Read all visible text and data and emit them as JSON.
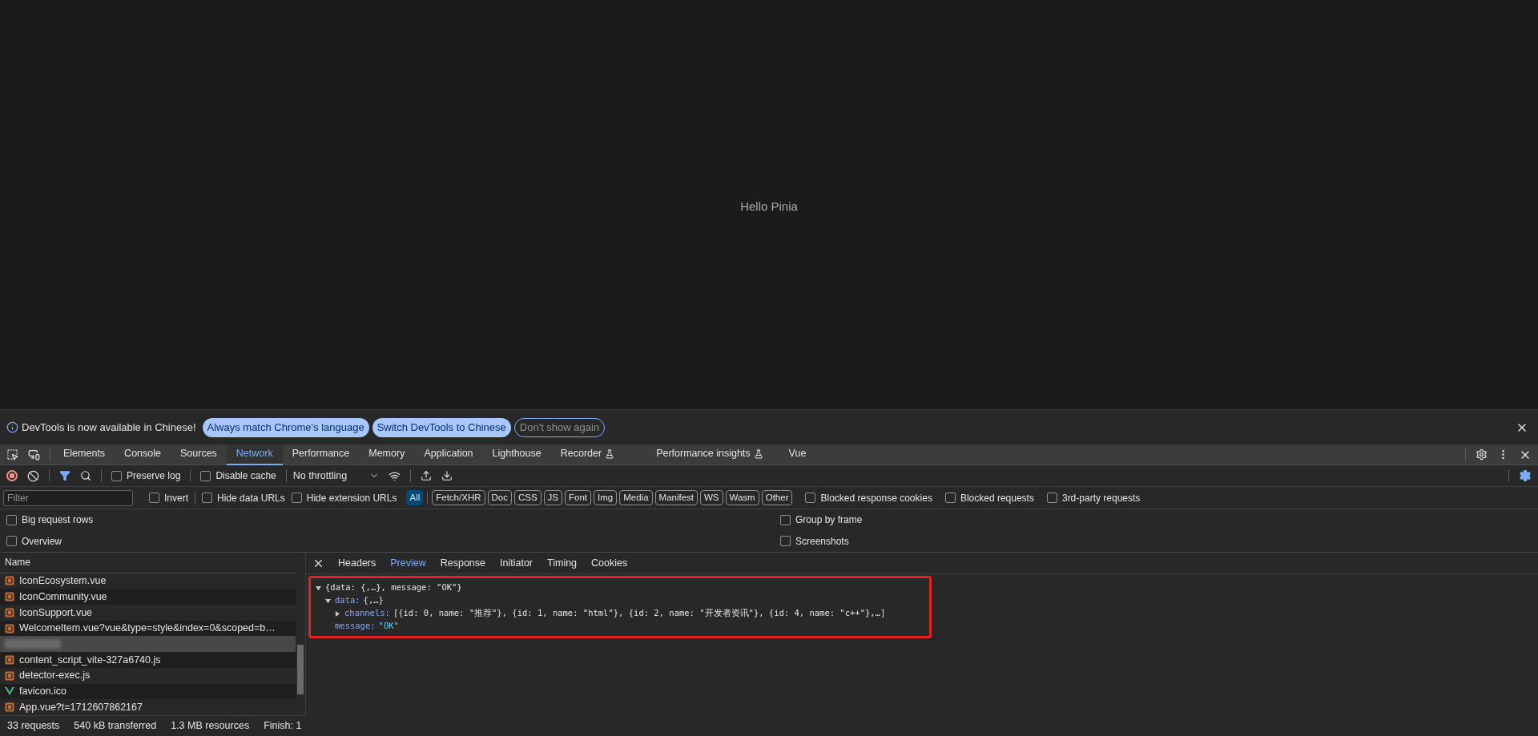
{
  "page": {
    "text": "Hello Pinia"
  },
  "infobar": {
    "message": "DevTools is now available in Chinese!",
    "buttons": [
      {
        "label": "Always match Chrome's language",
        "kind": "filled"
      },
      {
        "label": "Switch DevTools to Chinese",
        "kind": "filled"
      },
      {
        "label": "Don't show again",
        "kind": "outline"
      }
    ]
  },
  "tabs": [
    {
      "label": "Elements",
      "selected": false,
      "experimental": false
    },
    {
      "label": "Console",
      "selected": false,
      "experimental": false
    },
    {
      "label": "Sources",
      "selected": false,
      "experimental": false
    },
    {
      "label": "Network",
      "selected": true,
      "experimental": false
    },
    {
      "label": "Performance",
      "selected": false,
      "experimental": false
    },
    {
      "label": "Memory",
      "selected": false,
      "experimental": false
    },
    {
      "label": "Application",
      "selected": false,
      "experimental": false
    },
    {
      "label": "Lighthouse",
      "selected": false,
      "experimental": false
    },
    {
      "label": "Recorder",
      "selected": false,
      "experimental": true
    },
    {
      "label": "Performance insights",
      "selected": false,
      "experimental": true
    },
    {
      "label": "Vue",
      "selected": false,
      "experimental": false
    }
  ],
  "toolbar": {
    "recording": true,
    "checks": [
      {
        "label": "Preserve log",
        "checked": false
      },
      {
        "label": "Disable cache",
        "checked": false
      }
    ],
    "throttling": "No throttling"
  },
  "filter_bar": {
    "placeholder": "Filter",
    "checks": [
      {
        "label": "Invert",
        "checked": false
      },
      {
        "label": "Hide data URLs",
        "checked": false
      },
      {
        "label": "Hide extension URLs",
        "checked": false
      }
    ],
    "types": [
      {
        "label": "All",
        "selected": true
      },
      {
        "label": "Fetch/XHR",
        "selected": false
      },
      {
        "label": "Doc",
        "selected": false
      },
      {
        "label": "CSS",
        "selected": false
      },
      {
        "label": "JS",
        "selected": false
      },
      {
        "label": "Font",
        "selected": false
      },
      {
        "label": "Img",
        "selected": false
      },
      {
        "label": "Media",
        "selected": false
      },
      {
        "label": "Manifest",
        "selected": false
      },
      {
        "label": "WS",
        "selected": false
      },
      {
        "label": "Wasm",
        "selected": false
      },
      {
        "label": "Other",
        "selected": false
      }
    ],
    "more_checks": [
      {
        "label": "Blocked response cookies",
        "checked": false
      },
      {
        "label": "Blocked requests",
        "checked": false
      },
      {
        "label": "3rd-party requests",
        "checked": false
      }
    ]
  },
  "options": {
    "left": [
      {
        "label": "Big request rows",
        "checked": false
      },
      {
        "label": "Overview",
        "checked": false
      }
    ],
    "right": [
      {
        "label": "Group by frame",
        "checked": false
      },
      {
        "label": "Screenshots",
        "checked": false
      }
    ]
  },
  "requests": {
    "column": "Name",
    "rows": [
      {
        "name": "IconEcosystem.vue",
        "kind": "script",
        "selected": false
      },
      {
        "name": "IconCommunity.vue",
        "kind": "script",
        "selected": false
      },
      {
        "name": "IconSupport.vue",
        "kind": "script",
        "selected": false
      },
      {
        "name": "WelcomeItem.vue?vue&type=style&index=0&scoped=b…",
        "kind": "script",
        "selected": false
      },
      {
        "name": "",
        "kind": "blurred",
        "selected": true
      },
      {
        "name": "content_script_vite-327a6740.js",
        "kind": "script",
        "selected": false
      },
      {
        "name": "detector-exec.js",
        "kind": "script",
        "selected": false
      },
      {
        "name": "favicon.ico",
        "kind": "vue",
        "selected": false
      },
      {
        "name": "App.vue?t=1712607862167",
        "kind": "script",
        "selected": false
      }
    ]
  },
  "preview": {
    "tabs": [
      {
        "label": "Headers",
        "selected": false
      },
      {
        "label": "Preview",
        "selected": true
      },
      {
        "label": "Response",
        "selected": false
      },
      {
        "label": "Initiator",
        "selected": false
      },
      {
        "label": "Timing",
        "selected": false
      },
      {
        "label": "Cookies",
        "selected": false
      }
    ],
    "tree": [
      {
        "value": "{data: {,…}, message: \"OK\"}",
        "expanded": true,
        "children": [
          {
            "key": "data:",
            "value": "{,…}",
            "expanded": true,
            "children": [
              {
                "key": "channels:",
                "value": "[{id: 0, name: \"推荐\"}, {id: 1, name: \"html\"}, {id: 2, name: \"开发者资讯\"}, {id: 4, name: \"c++\"},…]",
                "expanded": false
              }
            ]
          },
          {
            "key": "message:",
            "value": "\"OK\"",
            "kind": "string"
          }
        ]
      }
    ]
  },
  "status_bar": [
    "33 requests",
    "540 kB transferred",
    "1.3 MB resources",
    "Finish: 1"
  ]
}
